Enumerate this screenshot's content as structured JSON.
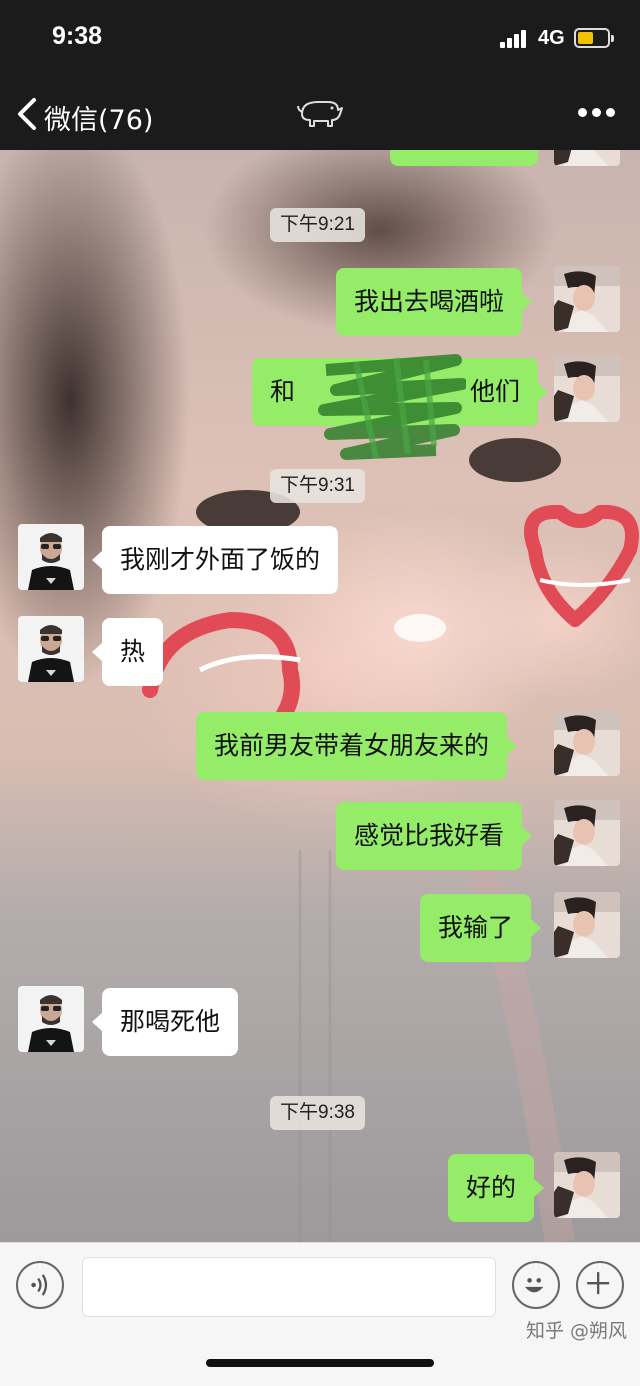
{
  "status_bar": {
    "time": "9:38",
    "network": "4G",
    "battery_level": 0.55
  },
  "header": {
    "back_label": "微信(76)",
    "title_icon": "pig-icon",
    "more_icon": "more-dots-icon"
  },
  "timestamps": [
    "下午9:21",
    "下午9:31",
    "下午9:38"
  ],
  "messages": [
    {
      "side": "out",
      "text": "我出去喝酒啦"
    },
    {
      "side": "out",
      "text": "和",
      "text_end": "他们",
      "censored": true
    },
    {
      "side": "in",
      "text": "我刚才外面了饭的"
    },
    {
      "side": "in",
      "text": "热"
    },
    {
      "side": "out",
      "text": "我前男友带着女朋友来的"
    },
    {
      "side": "out",
      "text": "感觉比我好看"
    },
    {
      "side": "out",
      "text": "我输了"
    },
    {
      "side": "in",
      "text": "那喝死他"
    },
    {
      "side": "out",
      "text": "好的"
    }
  ],
  "input_bar": {
    "voice_icon": "voice-icon",
    "emoji_icon": "emoji-icon",
    "plus_icon": "plus-icon"
  },
  "watermark": "知乎 @朔风",
  "colors": {
    "outgoing_bubble": "#95ec69",
    "incoming_bubble": "#ffffff",
    "header_bg": "#1b1b1b"
  }
}
